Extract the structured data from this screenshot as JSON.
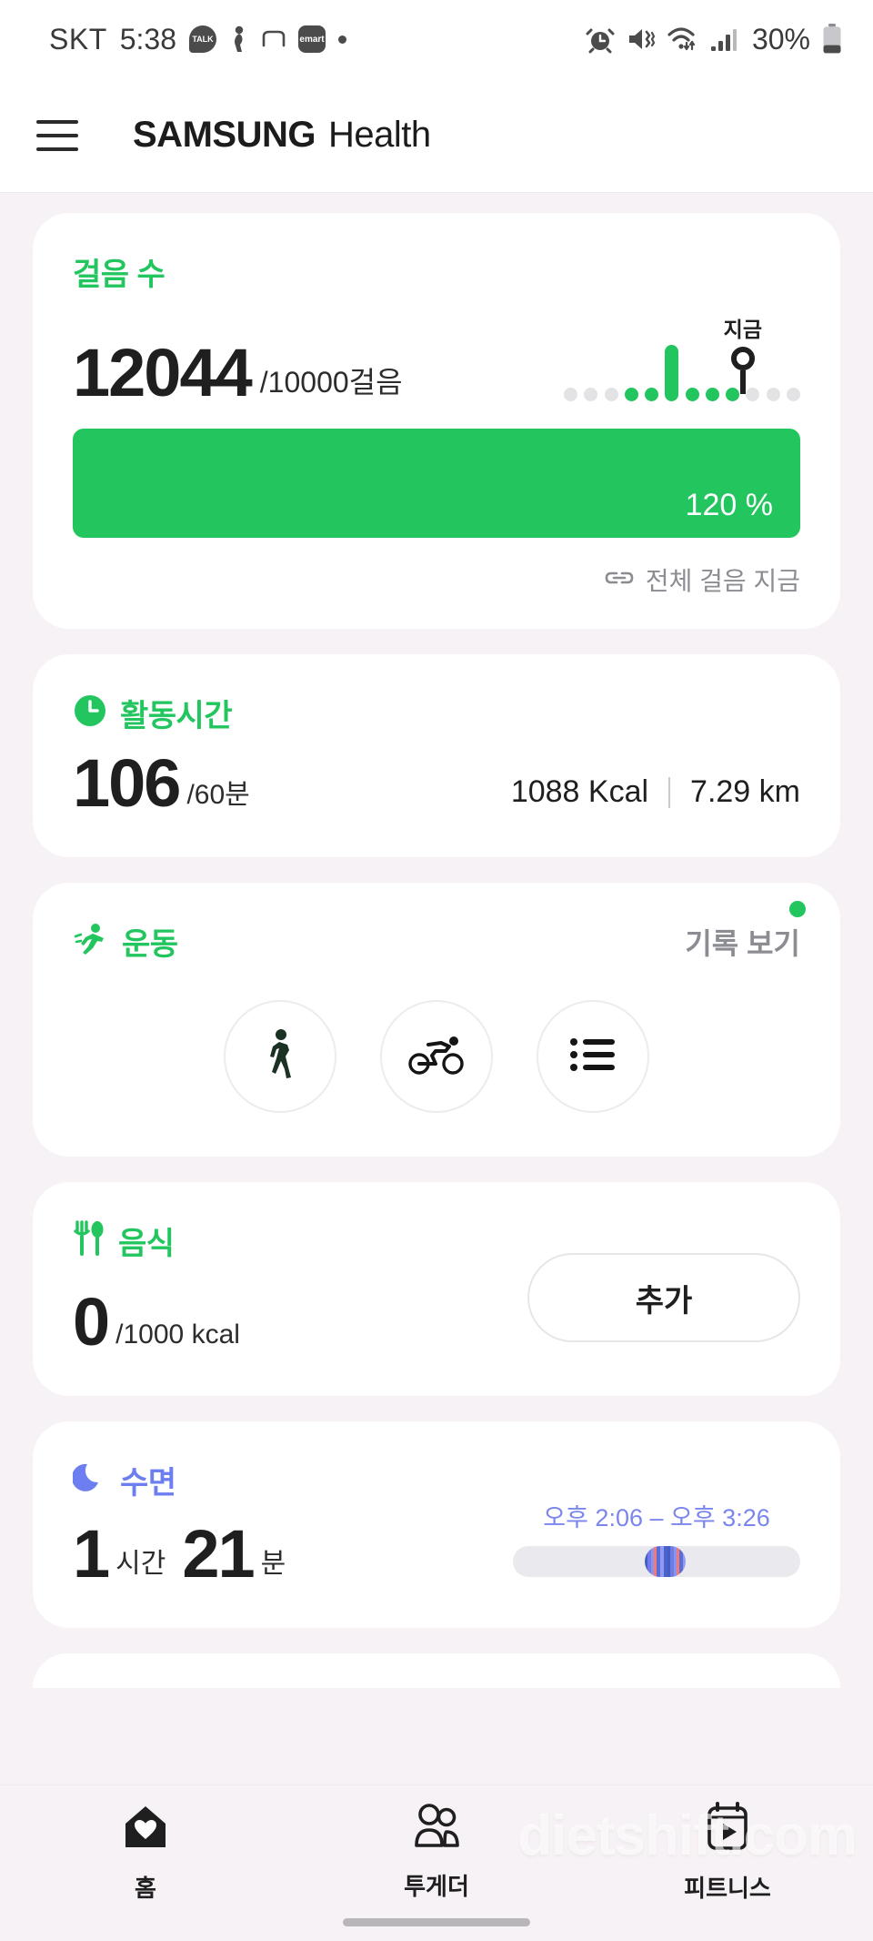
{
  "status_bar": {
    "carrier": "SKT",
    "time": "5:38",
    "app_badges": [
      "kakaotalk-icon",
      "figure-icon",
      "bracket-icon",
      "emart-icon",
      "dot-icon"
    ],
    "talk_label": "TALK",
    "emart_label": "emart",
    "right_icons": [
      "alarm-icon",
      "mute-vibrate-icon",
      "wifi-icon",
      "signal-icon"
    ],
    "battery_percent": "30%"
  },
  "header": {
    "menu_icon": "hamburger-icon",
    "brand_primary": "SAMSUNG",
    "brand_secondary": "Health"
  },
  "steps_card": {
    "title": "걸음 수",
    "value": "12044",
    "goal_unit": "/10000걸음",
    "progress_percent": "120 %",
    "progress_value": 120,
    "link_label": "전체 걸음 지금",
    "link_icon": "link-chain-icon",
    "now_label": "지금",
    "mini_chart": {
      "type": "bar",
      "points": [
        {
          "state": "off",
          "height": 0
        },
        {
          "state": "off",
          "height": 0
        },
        {
          "state": "off",
          "height": 0
        },
        {
          "state": "on",
          "height": 0
        },
        {
          "state": "on",
          "height": 0
        },
        {
          "state": "on",
          "height": 62
        },
        {
          "state": "on",
          "height": 0
        },
        {
          "state": "on",
          "height": 0
        },
        {
          "state": "on",
          "height": 0
        },
        {
          "state": "off",
          "height": 0
        },
        {
          "state": "off",
          "height": 0
        },
        {
          "state": "off",
          "height": 0
        }
      ]
    }
  },
  "activity_card": {
    "title": "활동시간",
    "title_icon": "clock-icon",
    "value": "106",
    "goal_unit": "/60분",
    "calories": "1088 Kcal",
    "distance": "7.29 km"
  },
  "exercise_card": {
    "title": "운동",
    "title_icon": "running-icon",
    "history_label": "기록 보기",
    "has_badge": true,
    "shortcuts": [
      {
        "icon": "walking-icon"
      },
      {
        "icon": "cycling-icon"
      },
      {
        "icon": "list-icon"
      }
    ]
  },
  "food_card": {
    "title": "음식",
    "title_icon": "fork-spoon-icon",
    "value": "0",
    "goal_unit": "/1000 kcal",
    "add_button": "추가"
  },
  "sleep_card": {
    "title": "수면",
    "title_icon": "moon-icon",
    "hours": "1",
    "hours_unit": "시간",
    "minutes": "21",
    "minutes_unit": "분",
    "time_range": "오후 2:06 – 오후 3:26"
  },
  "bottom_nav": [
    {
      "label": "홈",
      "icon": "home-heart-icon",
      "active": true
    },
    {
      "label": "투게더",
      "icon": "people-icon",
      "active": false
    },
    {
      "label": "피트니스",
      "icon": "fitness-play-icon",
      "active": false
    }
  ],
  "watermark": "dietshift.com",
  "colors": {
    "accent_green": "#22c55e",
    "sleep_blue": "#6d7ff0",
    "page_bg": "#f7f2f5",
    "card_bg": "#ffffff",
    "muted_text": "#8c8c93"
  }
}
